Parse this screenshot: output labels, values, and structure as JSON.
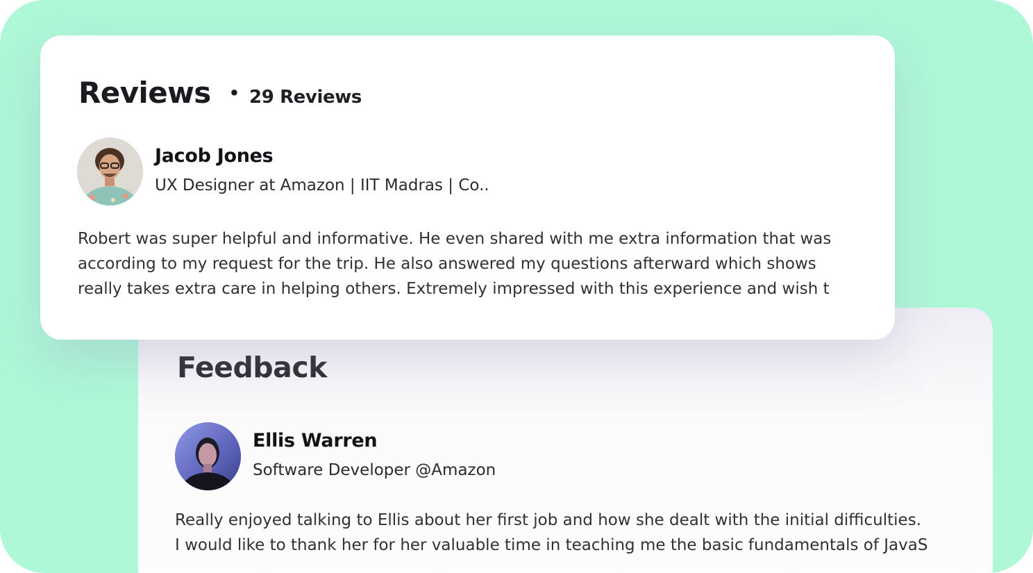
{
  "reviews": {
    "title": "Reviews",
    "separator": "•",
    "count": "29 Reviews",
    "reviewer": {
      "name": "Jacob Jones",
      "role": "UX Designer at Amazon | IIT Madras | Co.."
    },
    "text_lines": [
      "Robert was super helpful and informative. He even shared with me extra information that was",
      "according to my request for the trip. He also answered my questions afterward which shows",
      "really takes extra care in helping others. Extremely impressed with this experience and wish t"
    ]
  },
  "feedback": {
    "title": "Feedback",
    "reviewer": {
      "name": "Ellis Warren",
      "role": "Software Developer @Amazon"
    },
    "text_lines": [
      "Really enjoyed talking to Ellis about her first job and how she dealt with the initial difficulties.",
      "I would like to thank her for her valuable time in teaching me the basic fundamentals of JavaS"
    ]
  },
  "colors": {
    "background": "#aef7d7",
    "card": "#ffffff",
    "text": "#1f1f24"
  },
  "icons": {
    "jacob_avatar": "avatar-photo",
    "ellis_avatar": "avatar-photo"
  }
}
